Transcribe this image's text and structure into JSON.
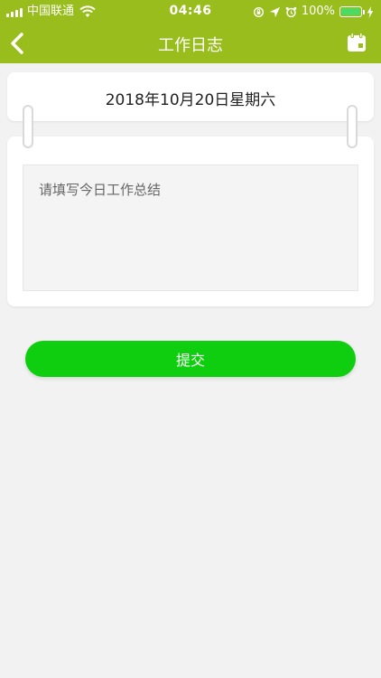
{
  "status_bar": {
    "carrier": "中国联通",
    "time": "04:46",
    "battery_percent": "100%",
    "battery_level": 1.0
  },
  "nav": {
    "title": "工作日志",
    "back_icon": "chevron-left-icon",
    "calendar_icon": "calendar-icon"
  },
  "date": {
    "text": "2018年10月20日星期六"
  },
  "summary": {
    "placeholder": "请填写今日工作总结",
    "value": ""
  },
  "actions": {
    "submit_label": "提交"
  },
  "colors": {
    "bar": "#98bd1c",
    "submit": "#0fce0f",
    "background": "#f2f2f2"
  }
}
